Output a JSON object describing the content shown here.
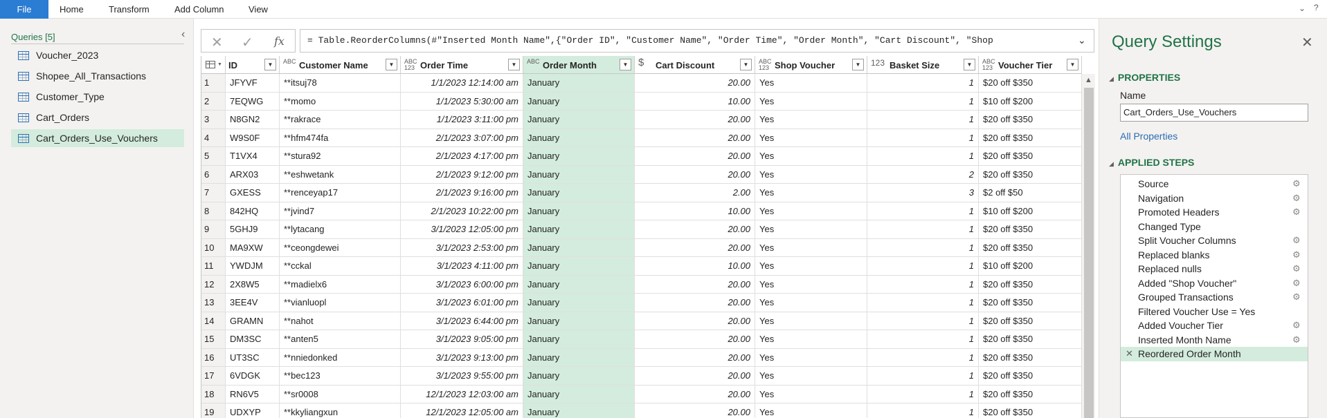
{
  "ribbon": {
    "tabs": [
      "File",
      "Home",
      "Transform",
      "Add Column",
      "View"
    ]
  },
  "queries": {
    "title": "Queries [5]",
    "items": [
      "Voucher_2023",
      "Shopee_All_Transactions",
      "Customer_Type",
      "Cart_Orders",
      "Cart_Orders_Use_Vouchers"
    ],
    "selected": "Cart_Orders_Use_Vouchers"
  },
  "formula": {
    "text": "= Table.ReorderColumns(#\"Inserted Month Name\",{\"Order ID\", \"Customer Name\", \"Order Time\", \"Order Month\", \"Cart Discount\", \"Shop"
  },
  "grid": {
    "columns": [
      {
        "type": "",
        "label": "ID"
      },
      {
        "type": "ABC",
        "label": "Customer Name"
      },
      {
        "type": "ABC 123",
        "label": "Order Time"
      },
      {
        "type": "ABC",
        "label": "Order Month"
      },
      {
        "type": "$",
        "label": "Cart Discount"
      },
      {
        "type": "ABC 123",
        "label": "Shop Voucher"
      },
      {
        "type": "123",
        "label": "Basket Size"
      },
      {
        "type": "ABC 123",
        "label": "Voucher Tier"
      }
    ],
    "selected_column": "Order Month",
    "rows": [
      [
        "1",
        "JFYVF",
        "**itsuj78",
        "1/1/2023 12:14:00 am",
        "January",
        "20.00",
        "Yes",
        "1",
        "$20 off $350"
      ],
      [
        "2",
        "7EQWG",
        "**momo",
        "1/1/2023 5:30:00 am",
        "January",
        "10.00",
        "Yes",
        "1",
        "$10 off $200"
      ],
      [
        "3",
        "N8GN2",
        "**rakrace",
        "1/1/2023 3:11:00 pm",
        "January",
        "20.00",
        "Yes",
        "1",
        "$20 off $350"
      ],
      [
        "4",
        "W9S0F",
        "**hfm474fa",
        "2/1/2023 3:07:00 pm",
        "January",
        "20.00",
        "Yes",
        "1",
        "$20 off $350"
      ],
      [
        "5",
        "T1VX4",
        "**stura92",
        "2/1/2023 4:17:00 pm",
        "January",
        "20.00",
        "Yes",
        "1",
        "$20 off $350"
      ],
      [
        "6",
        "ARX03",
        "**eshwetank",
        "2/1/2023 9:12:00 pm",
        "January",
        "20.00",
        "Yes",
        "2",
        "$20 off $350"
      ],
      [
        "7",
        "GXESS",
        "**renceyap17",
        "2/1/2023 9:16:00 pm",
        "January",
        "2.00",
        "Yes",
        "3",
        "$2 off $50"
      ],
      [
        "8",
        "842HQ",
        "**jvind7",
        "2/1/2023 10:22:00 pm",
        "January",
        "10.00",
        "Yes",
        "1",
        "$10 off $200"
      ],
      [
        "9",
        "5GHJ9",
        "**lytacang",
        "3/1/2023 12:05:00 pm",
        "January",
        "20.00",
        "Yes",
        "1",
        "$20 off $350"
      ],
      [
        "10",
        "MA9XW",
        "**ceongdewei",
        "3/1/2023 2:53:00 pm",
        "January",
        "20.00",
        "Yes",
        "1",
        "$20 off $350"
      ],
      [
        "11",
        "YWDJM",
        "**cckal",
        "3/1/2023 4:11:00 pm",
        "January",
        "10.00",
        "Yes",
        "1",
        "$10 off $200"
      ],
      [
        "12",
        "2X8W5",
        "**madielx6",
        "3/1/2023 6:00:00 pm",
        "January",
        "20.00",
        "Yes",
        "1",
        "$20 off $350"
      ],
      [
        "13",
        "3EE4V",
        "**vianluopl",
        "3/1/2023 6:01:00 pm",
        "January",
        "20.00",
        "Yes",
        "1",
        "$20 off $350"
      ],
      [
        "14",
        "GRAMN",
        "**nahot",
        "3/1/2023 6:44:00 pm",
        "January",
        "20.00",
        "Yes",
        "1",
        "$20 off $350"
      ],
      [
        "15",
        "DM3SC",
        "**anten5",
        "3/1/2023 9:05:00 pm",
        "January",
        "20.00",
        "Yes",
        "1",
        "$20 off $350"
      ],
      [
        "16",
        "UT3SC",
        "**nniedonked",
        "3/1/2023 9:13:00 pm",
        "January",
        "20.00",
        "Yes",
        "1",
        "$20 off $350"
      ],
      [
        "17",
        "6VDGK",
        "**bec123",
        "3/1/2023 9:55:00 pm",
        "January",
        "20.00",
        "Yes",
        "1",
        "$20 off $350"
      ],
      [
        "18",
        "RN6V5",
        "**sr0008",
        "12/1/2023 12:03:00 am",
        "January",
        "20.00",
        "Yes",
        "1",
        "$20 off $350"
      ],
      [
        "19",
        "UDXYP",
        "**kkyliangxun",
        "12/1/2023 12:05:00 am",
        "January",
        "20.00",
        "Yes",
        "1",
        "$20 off $350"
      ]
    ]
  },
  "settings": {
    "title": "Query Settings",
    "properties_title": "PROPERTIES",
    "name_label": "Name",
    "name_value": "Cart_Orders_Use_Vouchers",
    "all_properties": "All Properties",
    "steps_title": "APPLIED STEPS",
    "steps": [
      {
        "label": "Source",
        "gear": true
      },
      {
        "label": "Navigation",
        "gear": true
      },
      {
        "label": "Promoted Headers",
        "gear": true
      },
      {
        "label": "Changed Type",
        "gear": false
      },
      {
        "label": "Split Voucher Columns",
        "gear": true
      },
      {
        "label": "Replaced blanks",
        "gear": true
      },
      {
        "label": "Replaced nulls",
        "gear": true
      },
      {
        "label": "Added \"Shop Voucher\"",
        "gear": true
      },
      {
        "label": "Grouped Transactions",
        "gear": true
      },
      {
        "label": "Filtered Voucher Use = Yes",
        "gear": false
      },
      {
        "label": "Added Voucher Tier",
        "gear": true
      },
      {
        "label": "Inserted Month Name",
        "gear": true
      },
      {
        "label": "Reordered Order Month",
        "gear": false
      }
    ],
    "selected_step": "Reordered Order Month"
  },
  "colors": {
    "accent_green": "#217346",
    "selection_green": "#d3ecdd",
    "file_tab_blue": "#2b7cd3"
  }
}
